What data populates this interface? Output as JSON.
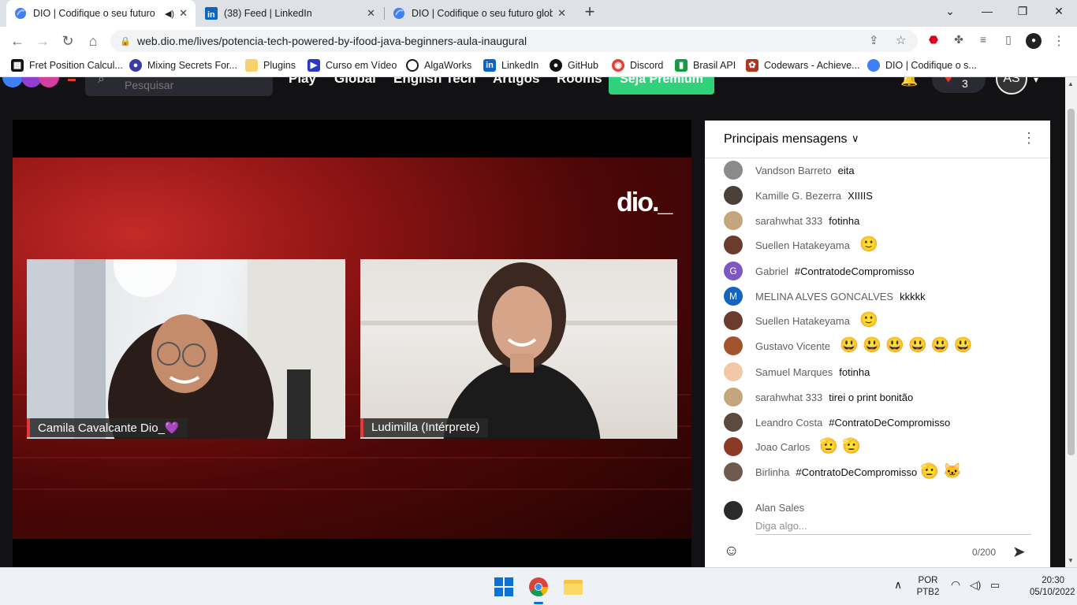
{
  "browser": {
    "tabs": [
      {
        "title": "DIO | Codifique o seu futuro",
        "icon": "dio-favicon",
        "active": true,
        "audio": true
      },
      {
        "title": "(38) Feed | LinkedIn",
        "icon": "linkedin-favicon",
        "active": false
      },
      {
        "title": "DIO | Codifique o seu futuro glob",
        "icon": "dio-favicon",
        "active": false
      }
    ],
    "url": "web.dio.me/lives/potencia-tech-powered-by-ifood-java-beginners-aula-inaugural",
    "bookmarks": [
      {
        "label": "Fret Position Calcul...",
        "icon": "piano-icon",
        "color": "#111111"
      },
      {
        "label": "Mixing Secrets For...",
        "icon": "disc-icon",
        "color": "#3a3aa8"
      },
      {
        "label": "Plugins",
        "icon": "folder-icon",
        "color": "#f6d26b"
      },
      {
        "label": "Curso em Vídeo",
        "icon": "cursoemvideo-icon",
        "color": "#2b39c7"
      },
      {
        "label": "AlgaWorks",
        "icon": "algaworks-icon",
        "color": "#1a1a1a"
      },
      {
        "label": "LinkedIn",
        "icon": "linkedin-icon",
        "color": "#0a66c2"
      },
      {
        "label": "GitHub",
        "icon": "github-icon",
        "color": "#111111"
      },
      {
        "label": "Discord",
        "icon": "discord-icon",
        "color": "#e0413c"
      },
      {
        "label": "Brasil API",
        "icon": "brasilapi-icon",
        "color": "#149b43"
      },
      {
        "label": "Codewars - Achieve...",
        "icon": "codewars-icon",
        "color": "#b1361e"
      },
      {
        "label": "DIO | Codifique o s...",
        "icon": "dio-favicon",
        "color": "#3f7ef5"
      }
    ]
  },
  "site": {
    "search_placeholder": "Pesquisar",
    "nav_links": [
      "Play",
      "Global",
      "English Tech",
      "Artigos",
      "Rooms"
    ],
    "premium_button": "Seja Premium",
    "hearts_count": "3",
    "avatar_initials": "AS"
  },
  "video": {
    "logo_text": "dio._",
    "participants": [
      {
        "name": "Camila Cavalcante Dio_💜"
      },
      {
        "name": "Ludimilla (Intérprete)"
      }
    ]
  },
  "chat": {
    "header": "Principais mensagens",
    "messages": [
      {
        "author": "Vandson Barreto",
        "text": "eita",
        "emoji": "",
        "avatar_color": "#8a8a8a",
        "initial": ""
      },
      {
        "author": "Kamille G. Bezerra",
        "text": "XIIIIS",
        "emoji": "",
        "avatar_color": "#4a4238",
        "initial": ""
      },
      {
        "author": "sarahwhat 333",
        "text": "fotinha",
        "emoji": "",
        "avatar_color": "#c4a57c",
        "initial": ""
      },
      {
        "author": "Suellen Hatakeyama",
        "text": "",
        "emoji": "🙂",
        "avatar_color": "#6b3b2e",
        "initial": ""
      },
      {
        "author": "Gabriel",
        "text": "#ContratodeCompromisso",
        "emoji": "",
        "avatar_color": "#7e57c2",
        "initial": "G"
      },
      {
        "author": "MELINA ALVES GONCALVES",
        "text": "kkkkk",
        "emoji": "",
        "avatar_color": "#1565c0",
        "initial": "M"
      },
      {
        "author": "Suellen Hatakeyama",
        "text": "",
        "emoji": "🙂",
        "avatar_color": "#6b3b2e",
        "initial": ""
      },
      {
        "author": "Gustavo Vicente",
        "text": "",
        "emoji": "😃 😃 😃 😃 😃 😃",
        "avatar_color": "#a3542e",
        "initial": ""
      },
      {
        "author": "Samuel Marques",
        "text": "fotinha",
        "emoji": "",
        "avatar_color": "#f2c9a6",
        "initial": ""
      },
      {
        "author": "sarahwhat 333",
        "text": "tirei o print bonitão",
        "emoji": "",
        "avatar_color": "#c4a57c",
        "initial": ""
      },
      {
        "author": "Leandro Costa",
        "text": "#ContratoDeCompromisso",
        "emoji": "",
        "avatar_color": "#5a4a40",
        "initial": ""
      },
      {
        "author": "Joao Carlos",
        "text": "",
        "emoji": "🫡 🫡",
        "avatar_color": "#8c3a28",
        "initial": ""
      },
      {
        "author": "Birlinha",
        "text": "#ContratoDeCompromisso",
        "emoji": "🫡 🐱",
        "avatar_color": "#6e5a50",
        "initial": ""
      }
    ],
    "composer": {
      "user": "Alan Sales",
      "placeholder": "Diga algo...",
      "char_count": "0/200"
    }
  },
  "taskbar": {
    "language": "POR",
    "layout": "PTB2",
    "time": "20:30",
    "date": "05/10/2022"
  }
}
